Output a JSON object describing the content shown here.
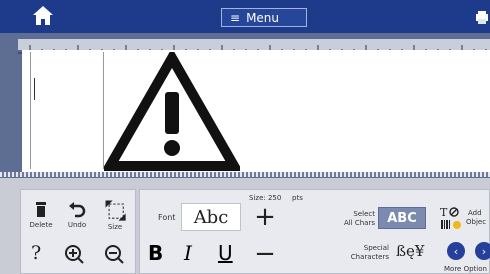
{
  "header": {
    "menu_label": "Menu"
  },
  "toolbar": {
    "object_tools": {
      "delete_label": "Delete",
      "undo_label": "Undo",
      "size_label": "Size"
    },
    "font": {
      "font_label": "Font",
      "font_preview": "Abc",
      "size_label": "Size: 250",
      "size_unit": "pts",
      "bold_label": "B",
      "italic_label": "I",
      "underline_label": "U"
    },
    "select_all_chars_label_1": "Select",
    "select_all_chars_label_2": "All Chars",
    "select_all_chars_button": "ABC",
    "special_characters_label_1": "Special",
    "special_characters_label_2": "Characters",
    "special_characters_glyph": "ßę¥",
    "add_object_label_1": "Add",
    "add_object_label_2": "Objec",
    "more_options_label": "More Option"
  },
  "icons": {
    "home": "home-icon",
    "menu": "hamburger-icon",
    "print": "printer-icon",
    "delete": "trash-icon",
    "undo": "undo-icon",
    "size": "resize-icon",
    "help": "question-icon",
    "zoom_in": "zoom-in-icon",
    "zoom_out": "zoom-out-icon",
    "prev": "chevron-left-icon",
    "next": "chevron-right-icon"
  },
  "colors": {
    "topbar": "#1e3a8a",
    "canvas_background": "#5e6e93",
    "toolbar_background": "#c9ccd4",
    "panel_background": "#e8eaef",
    "accent_button": "#24409a"
  }
}
